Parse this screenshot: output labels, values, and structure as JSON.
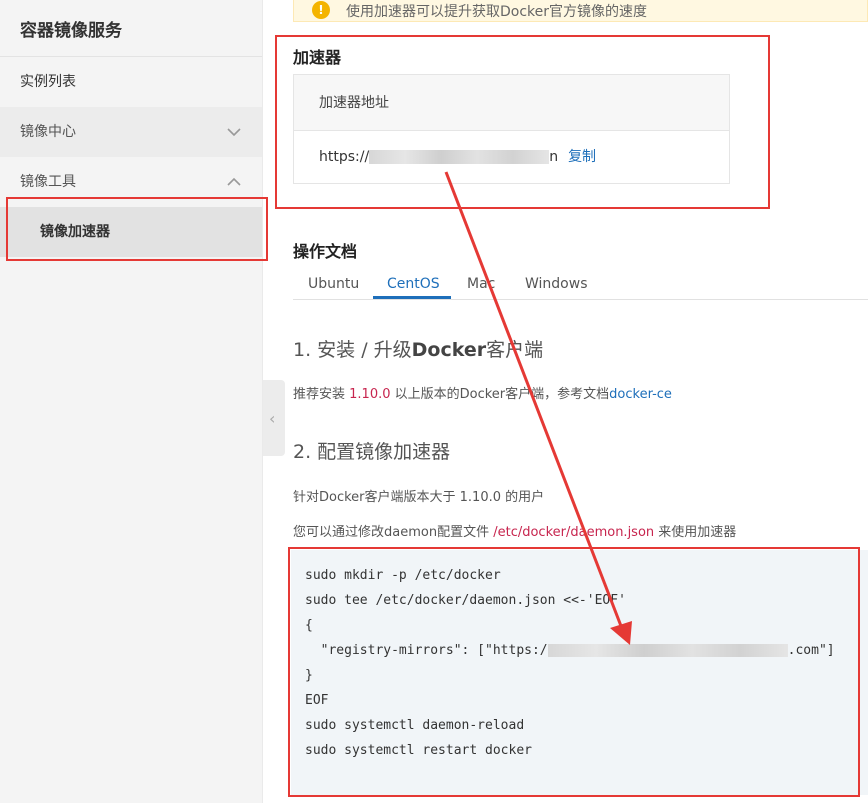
{
  "sidebar": {
    "title": "容器镜像服务",
    "items": [
      {
        "label": "实例列表"
      },
      {
        "label": "镜像中心",
        "chevron": "chevron-down-icon"
      },
      {
        "label": "镜像工具",
        "chevron": "chevron-up-icon"
      }
    ],
    "active_sub": "镜像加速器"
  },
  "notice": {
    "icon": "warning-icon",
    "text": "使用加速器可以提升获取Docker官方镜像的速度"
  },
  "accelerator": {
    "title": "加速器",
    "column_header": "加速器地址",
    "url_prefix": "https://",
    "url_suffix": "n",
    "copy_label": "复制"
  },
  "docs": {
    "title": "操作文档",
    "tabs": [
      "Ubuntu",
      "CentOS",
      "Mac",
      "Windows"
    ],
    "active_tab": "CentOS",
    "section1": {
      "heading_prefix": "1. 安装 / 升级",
      "heading_bold": "Docker",
      "heading_suffix": "客户端",
      "text_before": "推荐安装 ",
      "version": "1.10.0",
      "text_middle": " 以上版本的Docker客户端，参考文档",
      "link": "docker-ce"
    },
    "section2": {
      "heading": "2. 配置镜像加速器",
      "line1": "针对Docker客户端版本大于 1.10.0 的用户",
      "line2_before": "您可以通过修改daemon配置文件 ",
      "line2_path": "/etc/docker/daemon.json",
      "line2_after": " 来使用加速器"
    },
    "code": {
      "l1": "sudo mkdir -p /etc/docker",
      "l2": "sudo tee /etc/docker/daemon.json <<-'EOF'",
      "l3": "{",
      "l4_prefix": "  \"registry-mirrors\": [\"https:/",
      "l4_suffix": ".com\"]",
      "l5": "}",
      "l6": "EOF",
      "l7": "sudo systemctl daemon-reload",
      "l8": "sudo systemctl restart docker"
    }
  },
  "colors": {
    "link": "#1e6fba",
    "highlight": "#c7254e",
    "annotation": "#e53935"
  }
}
